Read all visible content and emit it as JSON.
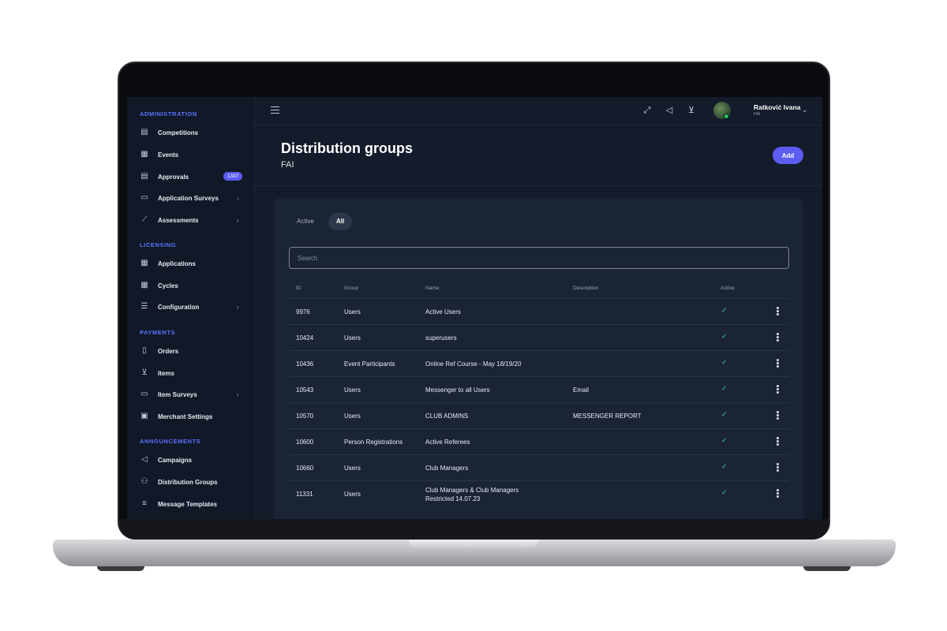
{
  "sidebar": {
    "sections": {
      "administration": "ADMINISTRATION",
      "licensing": "LICENSING",
      "payments": "PAYMENTS",
      "announcements": "ANNOUNCEMENTS"
    },
    "items": {
      "competitions": "Competitions",
      "events": "Events",
      "approvals": "Approvals",
      "approvals_badge": "1337",
      "application_surveys": "Application Surveys",
      "assessments": "Assessments",
      "applications": "Applications",
      "cycles": "Cycles",
      "configuration": "Configuration",
      "orders": "Orders",
      "items": "Items",
      "item_surveys": "Item Surveys",
      "merchant_settings": "Merchant Settings",
      "campaigns": "Campaigns",
      "distribution_groups": "Distribution Groups",
      "message_templates": "Message Templates"
    }
  },
  "topbar": {
    "user_name": "Ratković Ivana",
    "user_org": "FAI"
  },
  "page": {
    "title": "Distribution groups",
    "subtitle": "FAI",
    "add_label": "Add"
  },
  "tabs": {
    "active": "Active",
    "all": "All"
  },
  "search": {
    "placeholder": "Search"
  },
  "table": {
    "headers": {
      "id": "ID",
      "group": "Group",
      "name": "Name",
      "description": "Description",
      "active": "Active"
    },
    "rows": [
      {
        "id": "9976",
        "group": "Users",
        "name": "Active Users",
        "description": "",
        "active": "✓"
      },
      {
        "id": "10424",
        "group": "Users",
        "name": "superusers",
        "description": "",
        "active": "✓"
      },
      {
        "id": "10436",
        "group": "Event Participants",
        "name": "Online Ref Course - May 18/19/20",
        "description": "",
        "active": "✓"
      },
      {
        "id": "10543",
        "group": "Users",
        "name": "Messenger to all Users",
        "description": "Email",
        "active": "✓"
      },
      {
        "id": "10570",
        "group": "Users",
        "name": "CLUB ADMINS",
        "description": "MESSENGER REPORT",
        "active": "✓"
      },
      {
        "id": "10600",
        "group": "Person Registrations",
        "name": "Active Referees",
        "description": "",
        "active": "✓"
      },
      {
        "id": "10660",
        "group": "Users",
        "name": "Club Managers",
        "description": "",
        "active": "✓"
      },
      {
        "id": "11331",
        "group": "Users",
        "name": "Club Managers & Club Managers",
        "name2": "Restricted 14.07.23",
        "description": "",
        "active": "✓"
      }
    ]
  },
  "colors": {
    "accent": "#5a5df0",
    "check": "#34d399",
    "section_title": "#5b73ff"
  }
}
